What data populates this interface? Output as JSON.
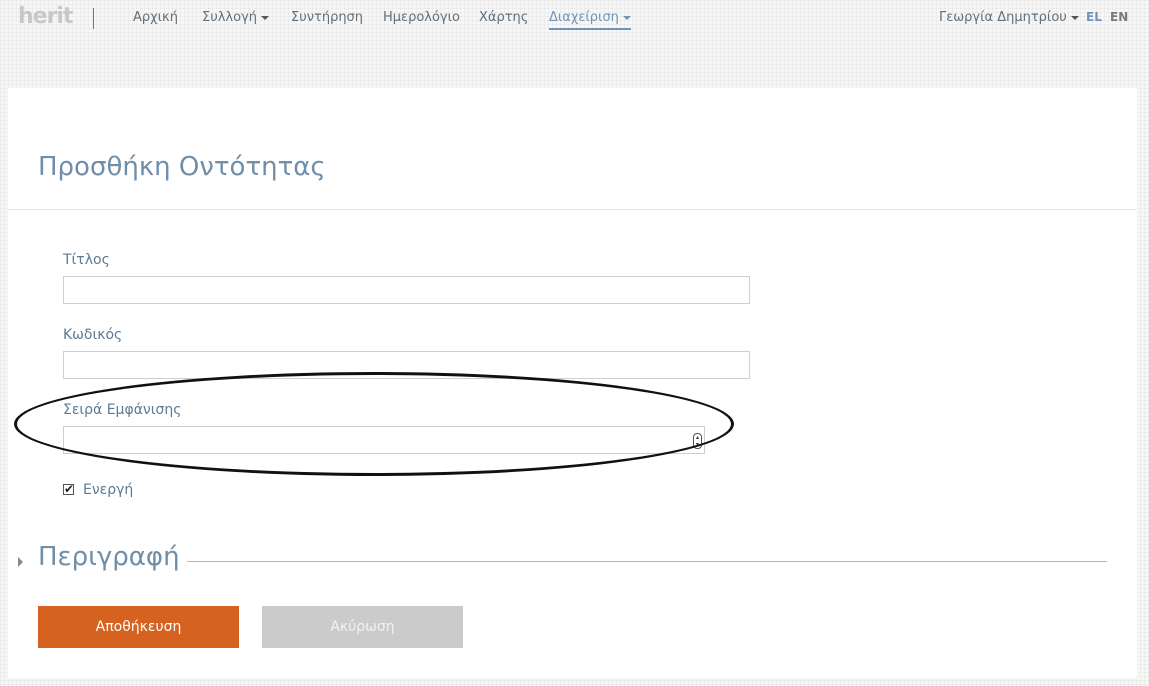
{
  "nav": {
    "logo": "herit",
    "items": [
      {
        "label": "Αρχική"
      },
      {
        "label": "Συλλογή"
      },
      {
        "label": "Συντήρηση"
      },
      {
        "label": "Ημερολόγιο"
      },
      {
        "label": "Χάρτης"
      },
      {
        "label": "Διαχείριση"
      }
    ],
    "user": "Γεωργία Δημητρίου",
    "lang_el": "EL",
    "lang_en": "EN"
  },
  "form": {
    "title": "Προσθήκη Οντότητας",
    "fields": {
      "title_label": "Τίτλος",
      "title_value": "",
      "code_label": "Κωδικός",
      "code_value": "",
      "order_label": "Σειρά Εμφάνισης",
      "order_value": ""
    },
    "active_label": "Ενεργή",
    "active_checked": true,
    "description_section": "Περιγραφή",
    "save_label": "Αποθήκευση",
    "cancel_label": "Ακύρωση"
  },
  "colors": {
    "accent": "#6f8ea9",
    "save": "#d5631f",
    "cancel": "#cbcbcb",
    "lang_active": "#6f94b8"
  }
}
